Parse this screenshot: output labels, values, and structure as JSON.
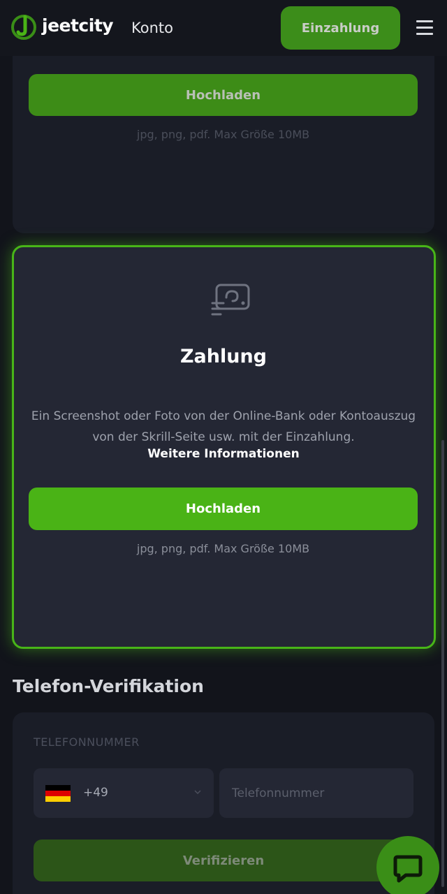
{
  "header": {
    "logo_text": "jeetcity",
    "title": "Konto",
    "deposit_label": "Einzahlung",
    "menu_icon": "hamburger-menu-icon"
  },
  "prev_card": {
    "upload_label": "Hochladen",
    "hint": "jpg, png, pdf. Max Größe 10MB"
  },
  "payment_card": {
    "icon": "payment-document-icon",
    "title": "Zahlung",
    "description": "Ein Screenshot oder Foto von der Online-Bank oder Kontoauszug von der Skrill-Seite usw. mit der Einzahlung.",
    "more_link": "Weitere Informationen",
    "upload_label": "Hochladen",
    "hint": "jpg, png, pdf. Max Größe 10MB"
  },
  "phone_verification": {
    "title": "Telefon-Verifikation",
    "field_label": "TELEFONNUMMER",
    "country_code": "+49",
    "country_flag": "germany-flag-icon",
    "phone_placeholder": "Telefonnummer",
    "verify_label": "Verifizieren"
  },
  "chat": {
    "icon": "chat-bubble-icon"
  },
  "colors": {
    "accent": "#4ab316",
    "accent_dim": "#3d8c17",
    "background": "#12141b",
    "card": "#242734"
  }
}
